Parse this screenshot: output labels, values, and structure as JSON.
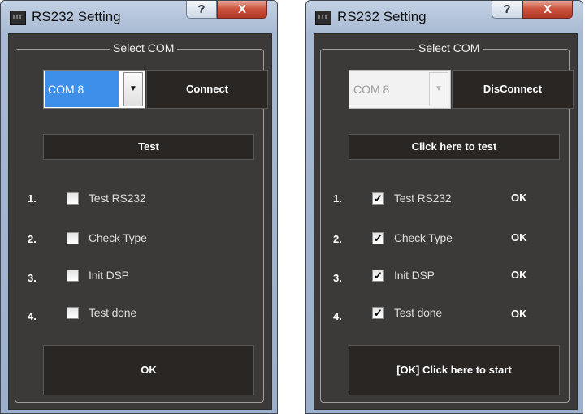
{
  "dialogs": [
    {
      "title": "RS232 Setting",
      "help_glyph": "?",
      "close_glyph": "X",
      "group_label": "Select COM",
      "combo": {
        "value": "COM 8",
        "state": "focused"
      },
      "connect_label": "Connect",
      "test_label": "Test",
      "steps": [
        {
          "num": "1.",
          "label": "Test RS232",
          "check": "",
          "status": ""
        },
        {
          "num": "2.",
          "label": "Check Type",
          "check": "",
          "status": ""
        },
        {
          "num": "3.",
          "label": "Init DSP",
          "check": "",
          "status": ""
        },
        {
          "num": "4.",
          "label": "Test done",
          "check": "",
          "status": ""
        }
      ],
      "start_label": "OK"
    },
    {
      "title": "RS232 Setting",
      "help_glyph": "?",
      "close_glyph": "X",
      "group_label": "Select COM",
      "combo": {
        "value": "COM 8",
        "state": "disabled"
      },
      "connect_label": "DisConnect",
      "test_label": "Click here to test",
      "steps": [
        {
          "num": "1.",
          "label": "Test RS232",
          "check": "✓",
          "status": "OK"
        },
        {
          "num": "2.",
          "label": "Check Type",
          "check": "✓",
          "status": "OK"
        },
        {
          "num": "3.",
          "label": "Init DSP",
          "check": "✓",
          "status": "OK"
        },
        {
          "num": "4.",
          "label": "Test done",
          "check": "✓",
          "status": "OK"
        }
      ],
      "start_label": "[OK] Click here to start"
    }
  ],
  "colors": {
    "client_background": "#3c3a38",
    "button_background": "#2a2624",
    "combo_selection": "#3d8fea",
    "close_button": "#c9503b"
  },
  "icons": {
    "app": "rs232-app-icon",
    "help": "help-icon",
    "close": "close-icon",
    "dropdown": "chevron-down-icon",
    "check": "checkmark-icon"
  }
}
